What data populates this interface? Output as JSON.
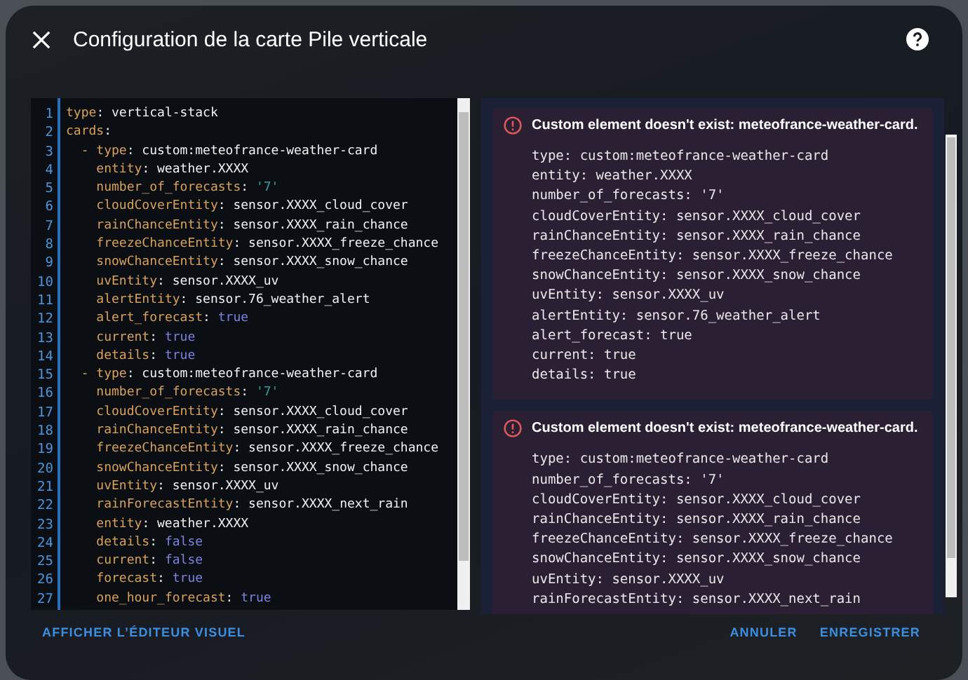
{
  "dialog": {
    "title": "Configuration de la carte Pile verticale"
  },
  "editor": {
    "lines": [
      {
        "number": "1",
        "kind": "root",
        "key": "type",
        "separator": ":",
        "value": {
          "text": "vertical-stack",
          "kind": "plain"
        }
      },
      {
        "number": "2",
        "kind": "root",
        "key": "cards",
        "separator": ":"
      },
      {
        "number": "3",
        "kind": "item",
        "dash": "-",
        "key": "type",
        "separator": ":",
        "value": {
          "text": "custom:meteofrance-weather-card",
          "kind": "plain"
        }
      },
      {
        "number": "4",
        "kind": "field",
        "key": "entity",
        "separator": ":",
        "value": {
          "text": "weather.XXXX",
          "kind": "plain"
        }
      },
      {
        "number": "5",
        "kind": "field",
        "key": "number_of_forecasts",
        "separator": ":",
        "value": {
          "text": "'7'",
          "kind": "string"
        }
      },
      {
        "number": "6",
        "kind": "field",
        "key": "cloudCoverEntity",
        "separator": ":",
        "value": {
          "text": "sensor.XXXX_cloud_cover",
          "kind": "plain"
        }
      },
      {
        "number": "7",
        "kind": "field",
        "key": "rainChanceEntity",
        "separator": ":",
        "value": {
          "text": "sensor.XXXX_rain_chance",
          "kind": "plain"
        }
      },
      {
        "number": "8",
        "kind": "field",
        "key": "freezeChanceEntity",
        "separator": ":",
        "value": {
          "text": "sensor.XXXX_freeze_chance",
          "kind": "plain"
        }
      },
      {
        "number": "9",
        "kind": "field",
        "key": "snowChanceEntity",
        "separator": ":",
        "value": {
          "text": "sensor.XXXX_snow_chance",
          "kind": "plain"
        }
      },
      {
        "number": "10",
        "kind": "field",
        "key": "uvEntity",
        "separator": ":",
        "value": {
          "text": "sensor.XXXX_uv",
          "kind": "plain"
        }
      },
      {
        "number": "11",
        "kind": "field",
        "key": "alertEntity",
        "separator": ":",
        "value": {
          "text": "sensor.76_weather_alert",
          "kind": "plain"
        }
      },
      {
        "number": "12",
        "kind": "field",
        "key": "alert_forecast",
        "separator": ":",
        "value": {
          "text": "true",
          "kind": "bool"
        }
      },
      {
        "number": "13",
        "kind": "field",
        "key": "current",
        "separator": ":",
        "value": {
          "text": "true",
          "kind": "bool"
        }
      },
      {
        "number": "14",
        "kind": "field",
        "key": "details",
        "separator": ":",
        "value": {
          "text": "true",
          "kind": "bool"
        }
      },
      {
        "number": "15",
        "kind": "item",
        "dash": "-",
        "key": "type",
        "separator": ":",
        "value": {
          "text": "custom:meteofrance-weather-card",
          "kind": "plain"
        }
      },
      {
        "number": "16",
        "kind": "field",
        "key": "number_of_forecasts",
        "separator": ":",
        "value": {
          "text": "'7'",
          "kind": "string"
        }
      },
      {
        "number": "17",
        "kind": "field",
        "key": "cloudCoverEntity",
        "separator": ":",
        "value": {
          "text": "sensor.XXXX_cloud_cover",
          "kind": "plain"
        }
      },
      {
        "number": "18",
        "kind": "field",
        "key": "rainChanceEntity",
        "separator": ":",
        "value": {
          "text": "sensor.XXXX_rain_chance",
          "kind": "plain"
        }
      },
      {
        "number": "19",
        "kind": "field",
        "key": "freezeChanceEntity",
        "separator": ":",
        "value": {
          "text": "sensor.XXXX_freeze_chance",
          "kind": "plain"
        }
      },
      {
        "number": "20",
        "kind": "field",
        "key": "snowChanceEntity",
        "separator": ":",
        "value": {
          "text": "sensor.XXXX_snow_chance",
          "kind": "plain"
        }
      },
      {
        "number": "21",
        "kind": "field",
        "key": "uvEntity",
        "separator": ":",
        "value": {
          "text": "sensor.XXXX_uv",
          "kind": "plain"
        }
      },
      {
        "number": "22",
        "kind": "field",
        "key": "rainForecastEntity",
        "separator": ":",
        "value": {
          "text": "sensor.XXXX_next_rain",
          "kind": "plain"
        }
      },
      {
        "number": "23",
        "kind": "field",
        "key": "entity",
        "separator": ":",
        "value": {
          "text": "weather.XXXX",
          "kind": "plain"
        }
      },
      {
        "number": "24",
        "kind": "field",
        "key": "details",
        "separator": ":",
        "value": {
          "text": "false",
          "kind": "bool"
        }
      },
      {
        "number": "25",
        "kind": "field",
        "key": "current",
        "separator": ":",
        "value": {
          "text": "false",
          "kind": "bool"
        }
      },
      {
        "number": "26",
        "kind": "field",
        "key": "forecast",
        "separator": ":",
        "value": {
          "text": "true",
          "kind": "bool"
        }
      },
      {
        "number": "27",
        "kind": "field",
        "key": "one_hour_forecast",
        "separator": ":",
        "value": {
          "text": "true",
          "kind": "bool"
        }
      }
    ]
  },
  "preview": {
    "errors": [
      {
        "title": "Custom element doesn't exist: meteofrance-weather-card.",
        "lines": [
          "type: custom:meteofrance-weather-card",
          "entity: weather.XXXX",
          "number_of_forecasts: '7'",
          "cloudCoverEntity: sensor.XXXX_cloud_cover",
          "rainChanceEntity: sensor.XXXX_rain_chance",
          "freezeChanceEntity: sensor.XXXX_freeze_chance",
          "snowChanceEntity: sensor.XXXX_snow_chance",
          "uvEntity: sensor.XXXX_uv",
          "alertEntity: sensor.76_weather_alert",
          "alert_forecast: true",
          "current: true",
          "details: true"
        ]
      },
      {
        "title": "Custom element doesn't exist: meteofrance-weather-card.",
        "lines": [
          "type: custom:meteofrance-weather-card",
          "number_of_forecasts: '7'",
          "cloudCoverEntity: sensor.XXXX_cloud_cover",
          "rainChanceEntity: sensor.XXXX_rain_chance",
          "freezeChanceEntity: sensor.XXXX_freeze_chance",
          "snowChanceEntity: sensor.XXXX_snow_chance",
          "uvEntity: sensor.XXXX_uv",
          "rainForecastEntity: sensor.XXXX_next_rain"
        ]
      }
    ]
  },
  "buttons": [
    {
      "label": "AFFICHER L’ÉDITEUR VISUEL",
      "kind": "left"
    },
    {
      "label": "ANNULER",
      "kind": "right"
    },
    {
      "label": "ENREGISTRER",
      "kind": "right"
    }
  ]
}
